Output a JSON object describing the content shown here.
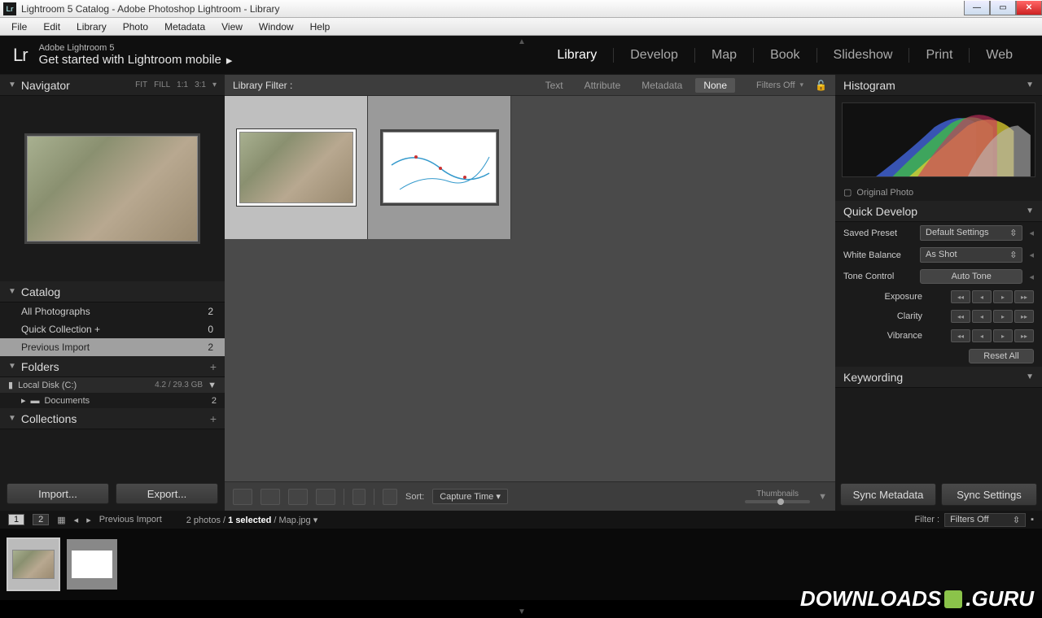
{
  "window": {
    "title": "Lightroom 5 Catalog - Adobe Photoshop Lightroom - Library"
  },
  "menu": [
    "File",
    "Edit",
    "Library",
    "Photo",
    "Metadata",
    "View",
    "Window",
    "Help"
  ],
  "header": {
    "logo": "Lr",
    "sub": "Adobe Lightroom 5",
    "main": "Get started with Lightroom mobile",
    "modules": [
      "Library",
      "Develop",
      "Map",
      "Book",
      "Slideshow",
      "Print",
      "Web"
    ],
    "active_module": "Library"
  },
  "left": {
    "navigator": {
      "title": "Navigator",
      "zoom": [
        "FIT",
        "FILL",
        "1:1",
        "3:1"
      ]
    },
    "catalog": {
      "title": "Catalog",
      "rows": [
        {
          "label": "All Photographs",
          "count": "2"
        },
        {
          "label": "Quick Collection  +",
          "count": "0"
        },
        {
          "label": "Previous Import",
          "count": "2"
        }
      ],
      "selected": 2
    },
    "folders": {
      "title": "Folders",
      "disk": {
        "label": "Local Disk (C:)",
        "usage": "4.2 / 29.3 GB"
      },
      "rows": [
        {
          "label": "Documents",
          "count": "2"
        }
      ]
    },
    "collections": {
      "title": "Collections"
    },
    "buttons": {
      "import": "Import...",
      "export": "Export..."
    }
  },
  "filter": {
    "label": "Library Filter :",
    "tabs": [
      "Text",
      "Attribute",
      "Metadata",
      "None"
    ],
    "active": 3,
    "off": "Filters Off"
  },
  "toolbar": {
    "sort_label": "Sort:",
    "sort_value": "Capture Time",
    "thumb_label": "Thumbnails"
  },
  "right": {
    "histogram": "Histogram",
    "original": "Original Photo",
    "quickdev": {
      "title": "Quick Develop",
      "preset_label": "Saved Preset",
      "preset_value": "Default Settings",
      "wb_label": "White Balance",
      "wb_value": "As Shot",
      "tone_label": "Tone Control",
      "auto": "Auto Tone",
      "exposure": "Exposure",
      "clarity": "Clarity",
      "vibrance": "Vibrance",
      "reset": "Reset All"
    },
    "keywording": "Keywording",
    "sync_meta": "Sync Metadata",
    "sync_set": "Sync Settings"
  },
  "status": {
    "page1": "1",
    "page2": "2",
    "source": "Previous Import",
    "count": "2 photos /",
    "selected": "1 selected",
    "file": "/ Map.jpg",
    "filter_label": "Filter :",
    "filter_value": "Filters Off"
  },
  "watermark": {
    "a": "DOWNLOADS",
    "b": ".GURU"
  }
}
